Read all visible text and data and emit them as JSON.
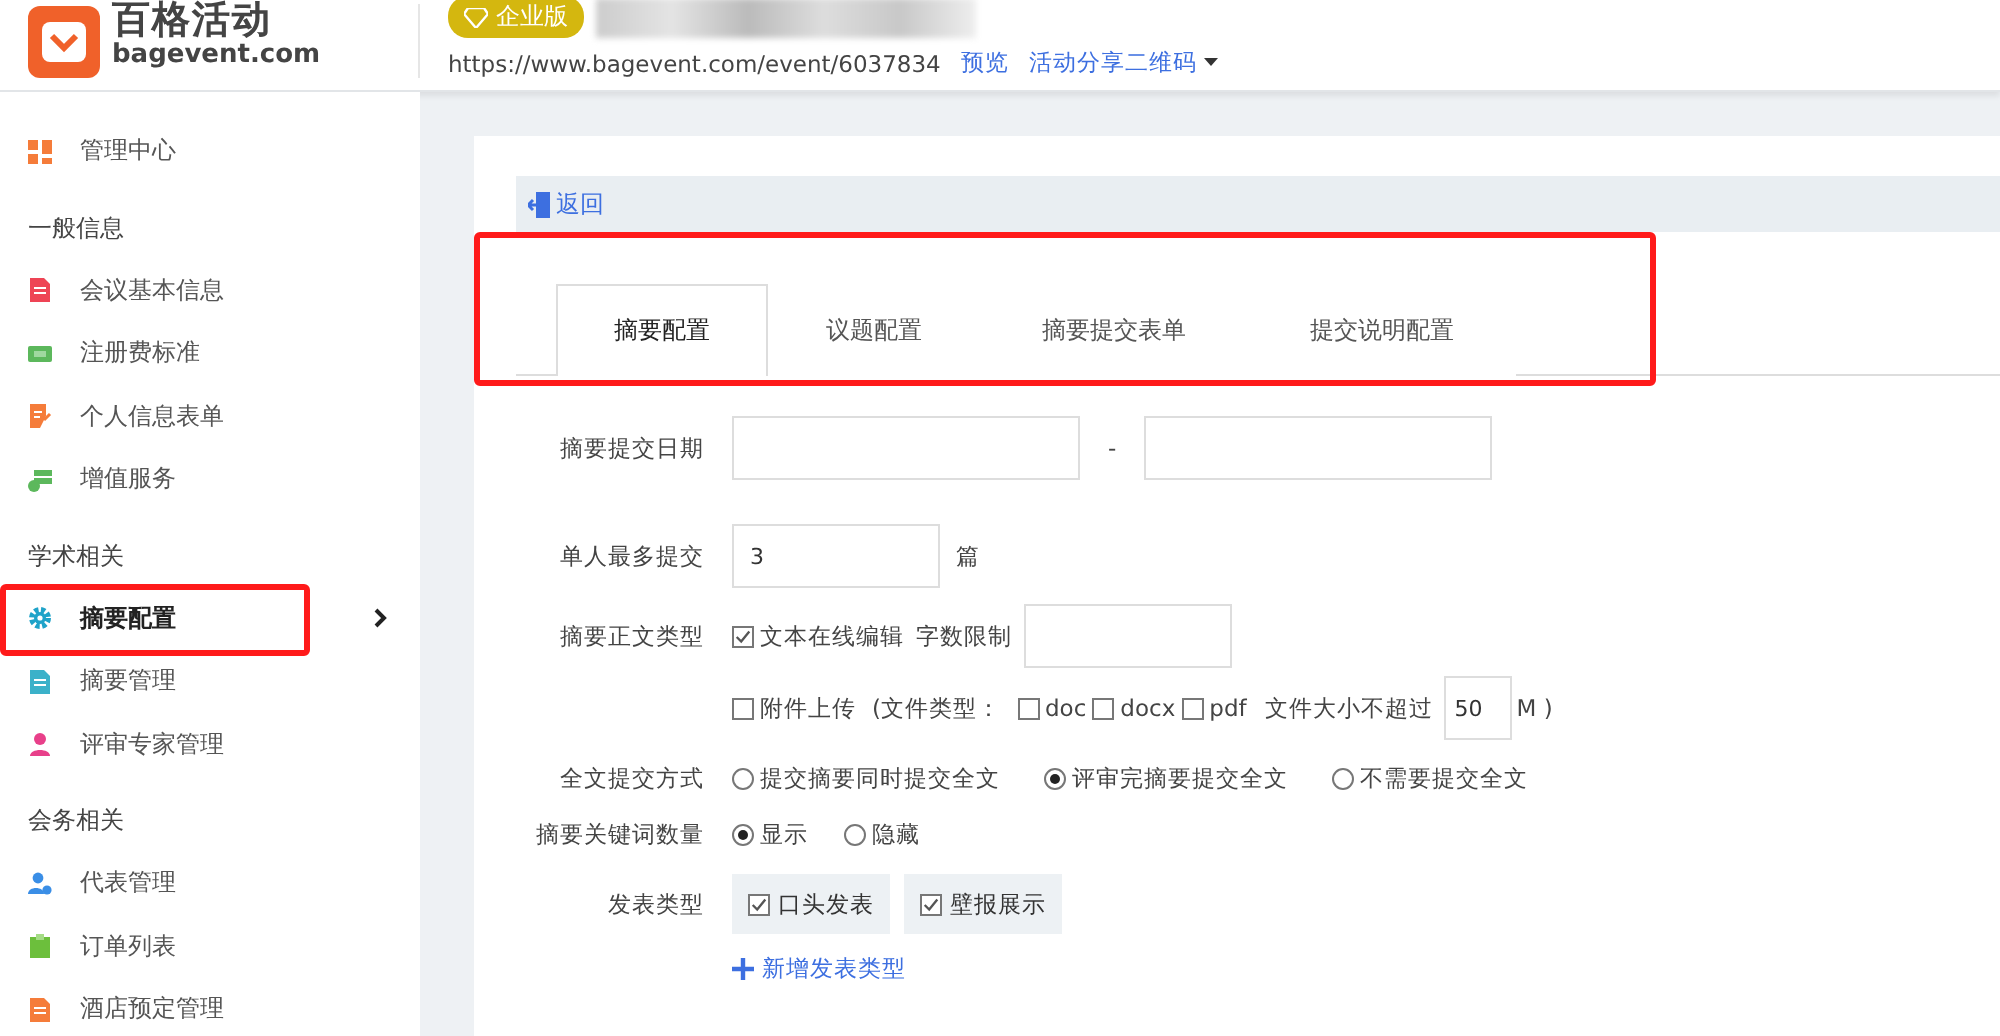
{
  "header": {
    "logo_name": "百格活动",
    "logo_domain": "bagevent.com",
    "edition_badge": "企业版",
    "event_url": "https://www.bagevent.com/event/6037834",
    "links": [
      {
        "label": "预览",
        "dropdown": false
      },
      {
        "label": "活动分享二维码",
        "dropdown": true
      }
    ]
  },
  "sidebar": {
    "items": [
      {
        "kind": "item",
        "label": "管理中心",
        "color": "#f57c3a",
        "selected": false
      },
      {
        "kind": "section",
        "label": "一般信息"
      },
      {
        "kind": "item",
        "label": "会议基本信息",
        "color": "#ee4455",
        "selected": false
      },
      {
        "kind": "item",
        "label": "注册费标准",
        "color": "#5cb85c",
        "selected": false
      },
      {
        "kind": "item",
        "label": "个人信息表单",
        "color": "#f57c3a",
        "selected": false
      },
      {
        "kind": "item",
        "label": "增值服务",
        "color": "#5cb85c",
        "selected": false
      },
      {
        "kind": "section",
        "label": "学术相关"
      },
      {
        "kind": "item",
        "label": "摘要配置",
        "color": "#1fa3c9",
        "selected": true
      },
      {
        "kind": "item",
        "label": "摘要管理",
        "color": "#3bb1c9",
        "selected": false
      },
      {
        "kind": "item",
        "label": "评审专家管理",
        "color": "#e8408a",
        "selected": false
      },
      {
        "kind": "section",
        "label": "会务相关"
      },
      {
        "kind": "item",
        "label": "代表管理",
        "color": "#3a8ee6",
        "selected": false
      },
      {
        "kind": "item",
        "label": "订单列表",
        "color": "#6cbf3c",
        "selected": false
      },
      {
        "kind": "item",
        "label": "酒店预定管理",
        "color": "#f57c3a",
        "selected": false
      }
    ]
  },
  "back_link": "返回",
  "tabs": [
    {
      "label": "摘要配置",
      "selected": true
    },
    {
      "label": "议题配置",
      "selected": false
    },
    {
      "label": "摘要提交表单",
      "selected": false
    },
    {
      "label": "提交说明配置",
      "selected": false
    }
  ],
  "form": {
    "date_label": "摘要提交日期",
    "date_separator": "-",
    "max_label": "单人最多提交",
    "max_value": "3",
    "max_unit": "篇",
    "body_label": "摘要正文类型",
    "online_edit": {
      "label": "文本在线编辑",
      "checked": true
    },
    "word_limit_label": "字数限制",
    "attachment": {
      "label": "附件上传",
      "checked": false
    },
    "file_types_label": "(文件类型：",
    "file_types": [
      {
        "label": "doc",
        "checked": false
      },
      {
        "label": "docx",
        "checked": false
      },
      {
        "label": "pdf",
        "checked": false
      }
    ],
    "size_label": "文件大小不超过",
    "size_value": "50",
    "size_unit": "M )",
    "fulltext_label": "全文提交方式",
    "fulltext_options": [
      {
        "label": "提交摘要同时提交全文",
        "selected": false
      },
      {
        "label": "评审完摘要提交全文",
        "selected": true
      },
      {
        "label": "不需要提交全文",
        "selected": false
      }
    ],
    "keywords_label": "摘要关键词数量",
    "keywords_options": [
      {
        "label": "显示",
        "selected": true
      },
      {
        "label": "隐藏",
        "selected": false
      }
    ],
    "publish_label": "发表类型",
    "publish_types": [
      {
        "label": "口头发表",
        "checked": true
      },
      {
        "label": "壁报展示",
        "checked": true
      }
    ],
    "add_type": "新增发表类型"
  }
}
